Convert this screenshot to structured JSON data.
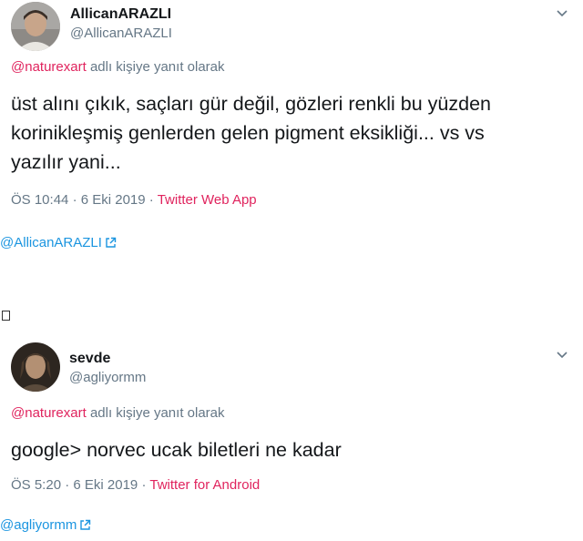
{
  "tweets": [
    {
      "display_name": "AllicanARAZLI",
      "handle": "@AllicanARAZLI",
      "reply_mention": "@naturexart",
      "reply_suffix": "adlı kişiye yanıt olarak",
      "text_lines": [
        "üst alını çıkık, saçları gür değil, gözleri renkli bu yüzden",
        "korinikleşmiş genlerden gelen pigment eksikliği...  vs vs",
        "yazılır yani..."
      ],
      "time": "ÖS 10:44",
      "date": "6 Eki 2019",
      "source": "Twitter Web App",
      "credit": "@AllicanARAZLI"
    },
    {
      "display_name": "sevde",
      "handle": "@agliyormm",
      "reply_mention": "@naturexart",
      "reply_suffix": "adlı kişiye yanıt olarak",
      "text_lines": [
        "google> norvec ucak biletleri ne kadar"
      ],
      "time": "ÖS 5:20",
      "date": "6 Eki 2019",
      "source": "Twitter for Android",
      "credit": "@agliyormm"
    }
  ],
  "separator": "·",
  "colors": {
    "link": "#1b95e0",
    "mention": "#e0245e",
    "muted": "#657786",
    "text": "#14171a"
  },
  "icons": {
    "menu": "chevron-down-icon",
    "external": "external-link-icon"
  }
}
